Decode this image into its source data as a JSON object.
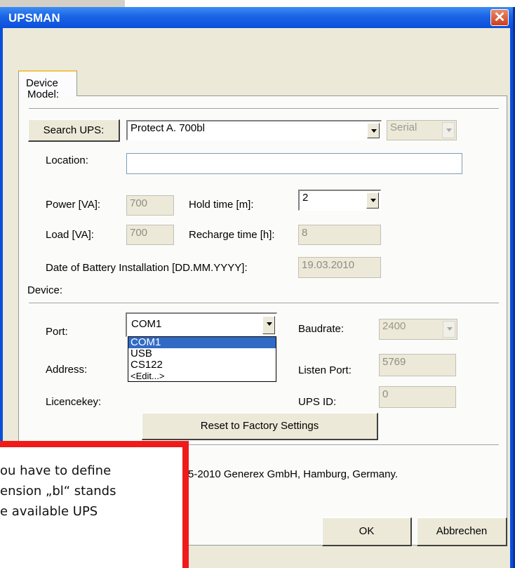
{
  "dialog": {
    "title": "UPSMAN",
    "close_symbol": "✕",
    "tab_label": "Device",
    "model_group": "Model:",
    "search_ups_button": "Search UPS:",
    "model_value": "Protect A.  700bl",
    "connection_value": "Serial",
    "location_label": "Location:",
    "location_value": "",
    "power_label": "Power [VA]:",
    "power_value": "700",
    "hold_time_label": "Hold time [m]:",
    "hold_time_value": "2",
    "load_label": "Load [VA]:",
    "load_value": "700",
    "recharge_label": "Recharge time [h]:",
    "recharge_value": "8",
    "battery_date_label": "Date of Battery Installation [DD.MM.YYYY]:",
    "battery_date_value": "19.03.2010",
    "device_group": "Device:",
    "port_label": "Port:",
    "port_value": "COM1",
    "port_options": [
      "COM1",
      "USB",
      "CS122",
      "<Edit...>"
    ],
    "baudrate_label": "Baudrate:",
    "baudrate_value": "2400",
    "address_label": "Address:",
    "listen_port_label": "Listen Port:",
    "listen_port_value": "5769",
    "licencekey_label": "Licencekey:",
    "ups_id_label": "UPS ID:",
    "ups_id_value": "0",
    "reset_button": "Reset to Factory Settings",
    "copyright": "5-2010 Generex GmbH, Hamburg, Germany.",
    "ok_button": "OK",
    "cancel_button": "Abbrechen"
  },
  "callout": {
    "line1": "ou have to define",
    "line2": "ension „bl“ stands",
    "line3": "e available UPS"
  },
  "colors": {
    "titlebar": "#0b4fdb",
    "dialog_bg": "#ece9d8",
    "selection": "#316ac5",
    "callout_border": "#ef1a1a"
  }
}
